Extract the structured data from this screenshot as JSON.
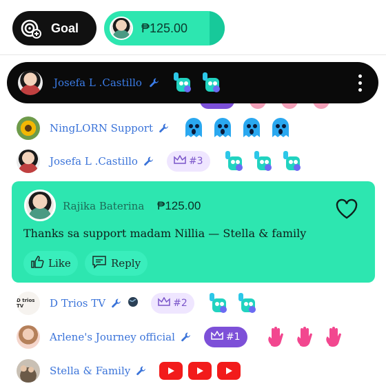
{
  "topbar": {
    "cut_text": "...",
    "goal_label": "Goal",
    "amount": "₱125.00"
  },
  "pinned": {
    "name": "Josefa L .Castillo"
  },
  "rows": [
    {
      "name": "NingLORN Support"
    },
    {
      "name": "Josefa L .Castillo",
      "rank": "#3"
    },
    {
      "name": "D Trios TV",
      "rank": "#2",
      "avatar_text": "D trios TV"
    },
    {
      "name": "Arlene's Journey official",
      "rank": "#1"
    },
    {
      "name": "Stella & Family"
    }
  ],
  "card": {
    "name": "Rajika Baterina",
    "amount": "₱125.00",
    "message": "Thanks sa support madam Nillia — Stella & family",
    "like_label": "Like",
    "reply_label": "Reply"
  },
  "colors": {
    "accent_green": "#2de6b0",
    "name_blue": "#3a73d9",
    "rank_purple": "#7d50d8"
  }
}
